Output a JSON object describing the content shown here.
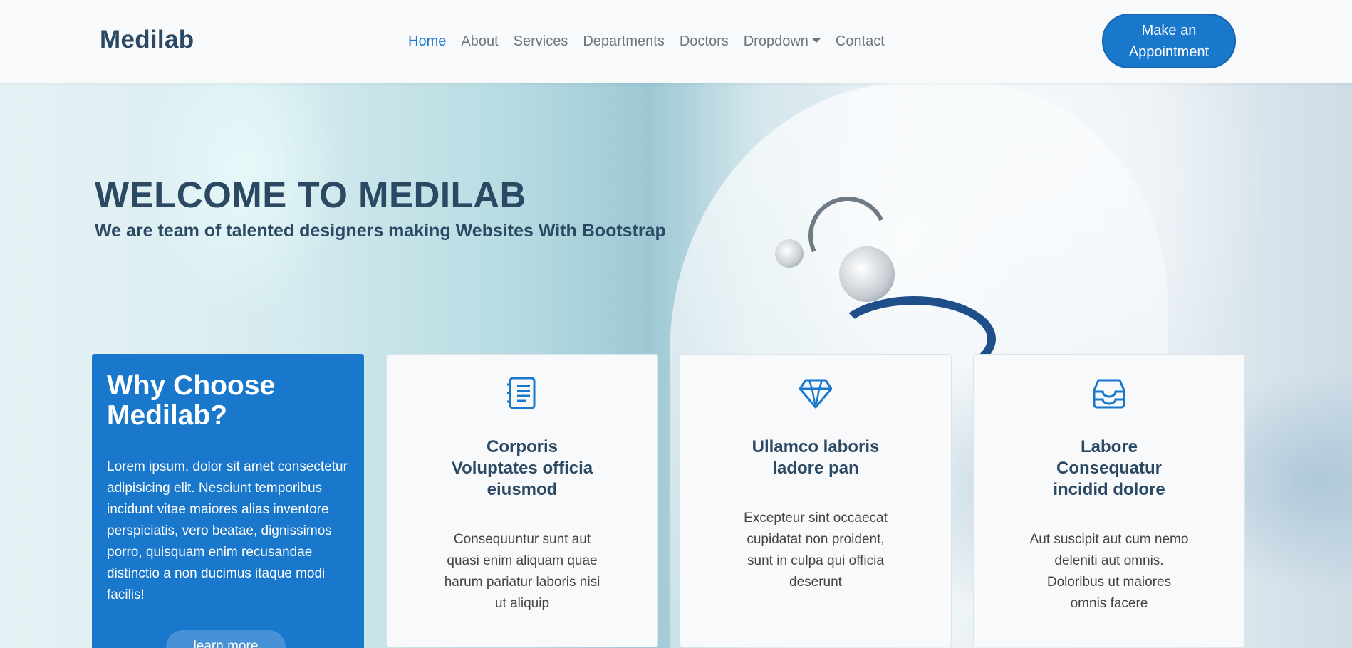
{
  "header": {
    "logo": "Medilab",
    "nav": [
      {
        "label": "Home",
        "active": true
      },
      {
        "label": "About"
      },
      {
        "label": "Services"
      },
      {
        "label": "Departments"
      },
      {
        "label": "Doctors"
      },
      {
        "label": "Dropdown",
        "has_caret": true
      },
      {
        "label": "Contact"
      }
    ],
    "cta_line1": "Make an",
    "cta_line2": "Appointment"
  },
  "hero": {
    "title": "WELCOME TO MEDILAB",
    "subtitle": "We are team of talented designers making Websites With Bootstrap"
  },
  "why": {
    "title_line1": "Why Choose",
    "title_line2": "Medilab?",
    "text": "Lorem ipsum, dolor sit amet consectetur adipisicing elit. Nesciunt temporibus incidunt vitae maiores alias inventore perspiciatis, vero beatae, dignissimos porro, quisquam enim recusandae distinctio a non ducimus itaque modi facilis!",
    "button": "learn more"
  },
  "cards": [
    {
      "icon": "notebook-list-icon",
      "title": "Corporis Voluptates officia eiusmod",
      "text": "Consequuntur sunt aut quasi enim aliquam quae harum pariatur laboris nisi ut aliquip"
    },
    {
      "icon": "gem-icon",
      "title": "Ullamco laboris ladore pan",
      "text": "Excepteur sint occaecat cupidatat non proident, sunt in culpa qui officia deserunt"
    },
    {
      "icon": "inbox-tray-icon",
      "title": "Labore Consequatur incidid dolore",
      "text": "Aut suscipit aut cum nemo deleniti aut omnis. Doloribus ut maiores omnis facere"
    }
  ],
  "colors": {
    "accent": "#1977cc",
    "heading": "#2c4964",
    "nav_text": "#6c757d"
  }
}
